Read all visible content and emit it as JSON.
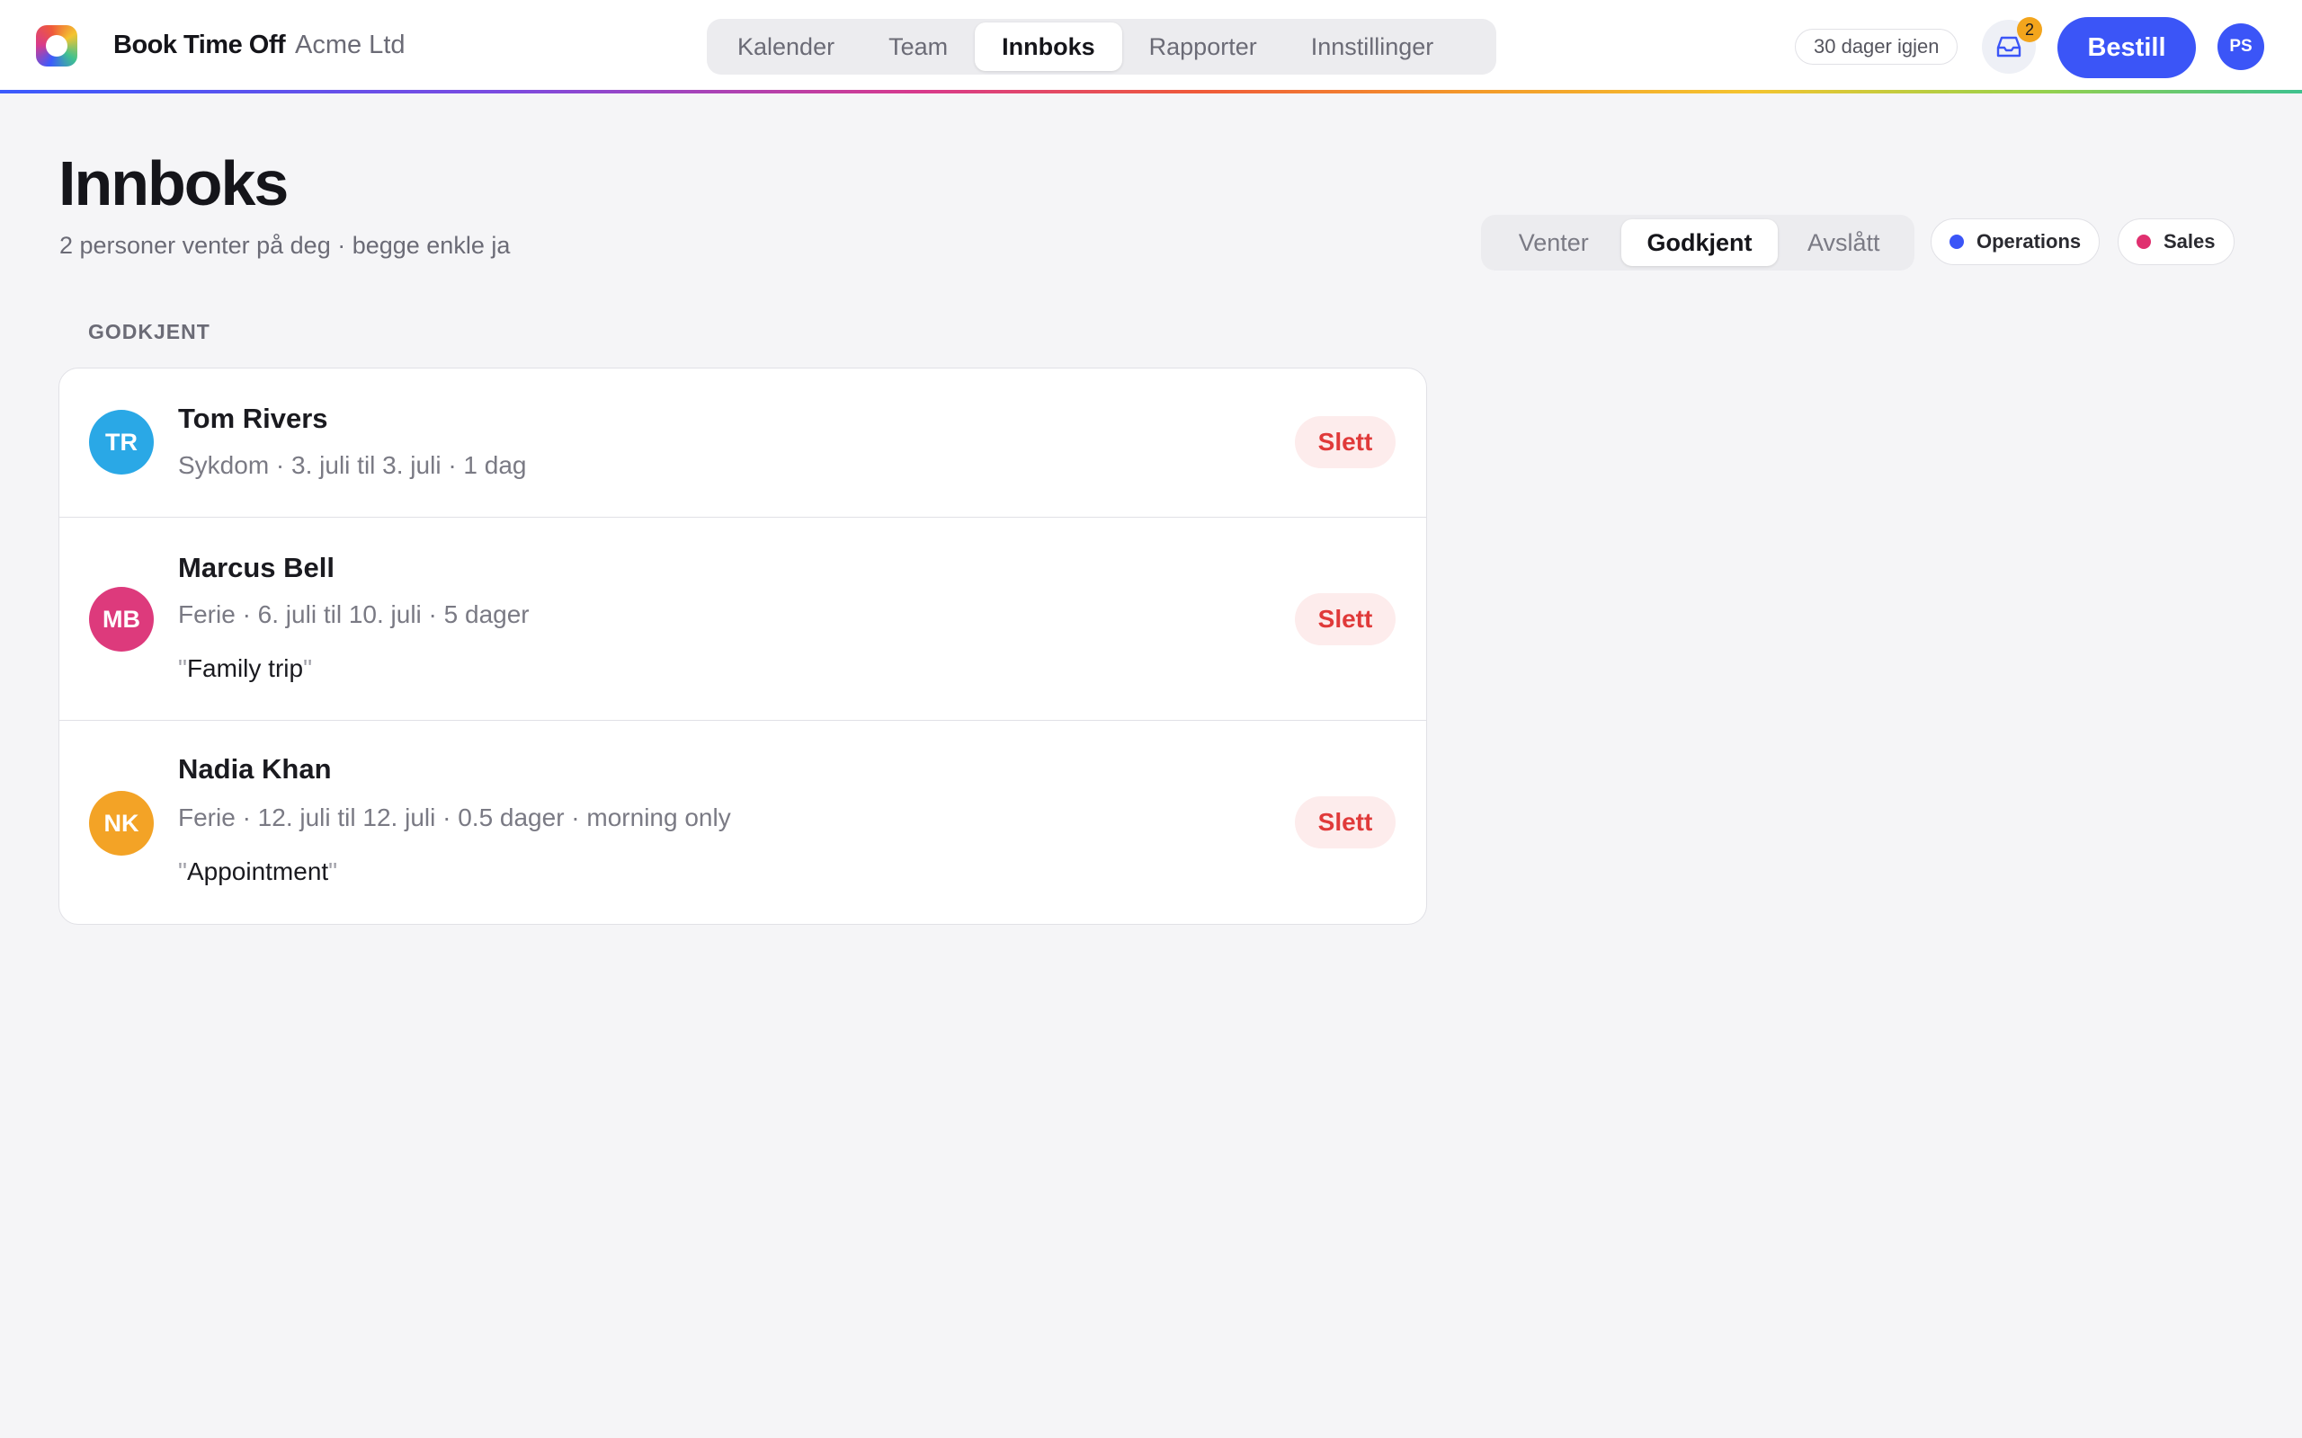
{
  "header": {
    "brand": "Book Time Off",
    "org": "Acme Ltd",
    "nav": [
      "Kalender",
      "Team",
      "Innboks",
      "Rapporter",
      "Innstillinger"
    ],
    "nav_active": "Innboks",
    "trial": "30 dager igjen",
    "inbox_badge": "2",
    "order_label": "Bestill",
    "user_initials": "PS",
    "icons": {
      "logo": "app-logo",
      "inbox": "inbox-tray-icon"
    }
  },
  "page": {
    "title": "Innboks",
    "subtitle": "2 personer venter på deg · begge enkle ja",
    "filters": [
      "Venter",
      "Godkjent",
      "Avslått"
    ],
    "filter_active": "Godkjent",
    "chips": [
      {
        "label": "Operations",
        "color": "#3b55f7"
      },
      {
        "label": "Sales",
        "color": "#e0306f"
      }
    ],
    "section_label": "GODKJENT"
  },
  "requests": [
    {
      "initials": "TR",
      "avatar_color": "#2aa8e6",
      "name": "Tom Rivers",
      "meta": "Sykdom · 3. juli til 3. juli · 1 dag",
      "note": "",
      "action": "Slett"
    },
    {
      "initials": "MB",
      "avatar_color": "#dd3a7c",
      "name": "Marcus Bell",
      "meta": "Ferie · 6. juli til 10. juli · 5 dager",
      "note": "Family trip",
      "action": "Slett"
    },
    {
      "initials": "NK",
      "avatar_color": "#f3a326",
      "name": "Nadia Khan",
      "meta": "Ferie · 12. juli til 12. juli · 0.5 dager · morning only",
      "note": "Appointment",
      "action": "Slett"
    }
  ],
  "colors": {
    "accent": "#3b55f7",
    "danger": "#e03a3a",
    "danger_bg": "#fdecec",
    "badge": "#f3a51c"
  }
}
